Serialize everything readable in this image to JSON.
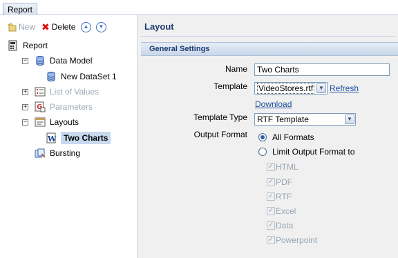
{
  "tab": {
    "label": "Report"
  },
  "toolbar": {
    "new_label": "New",
    "delete_label": "Delete"
  },
  "tree": {
    "root": "Report",
    "data_model": "Data Model",
    "dataset": "New DataSet 1",
    "list_of_values": "List of Values",
    "parameters": "Parameters",
    "layouts": "Layouts",
    "two_charts": "Two Charts",
    "bursting": "Bursting"
  },
  "main": {
    "title": "Layout",
    "section": "General Settings",
    "name_label": "Name",
    "name_value": "Two Charts",
    "template_label": "Template",
    "template_value": "VideoStores.rtf",
    "refresh_link": "Refresh",
    "download_link": "Download",
    "template_type_label": "Template Type",
    "template_type_value": "RTF Template",
    "output_format_label": "Output Format",
    "all_formats": "All Formats",
    "limit_formats": "Limit Output Format to",
    "formats": [
      "HTML",
      "PDF",
      "RTF",
      "Excel",
      "Data",
      "Powerpoint"
    ]
  },
  "colors": {
    "accent": "#1e3c72",
    "selection": "#c8d9ef",
    "panel": "#f0f0f0"
  }
}
